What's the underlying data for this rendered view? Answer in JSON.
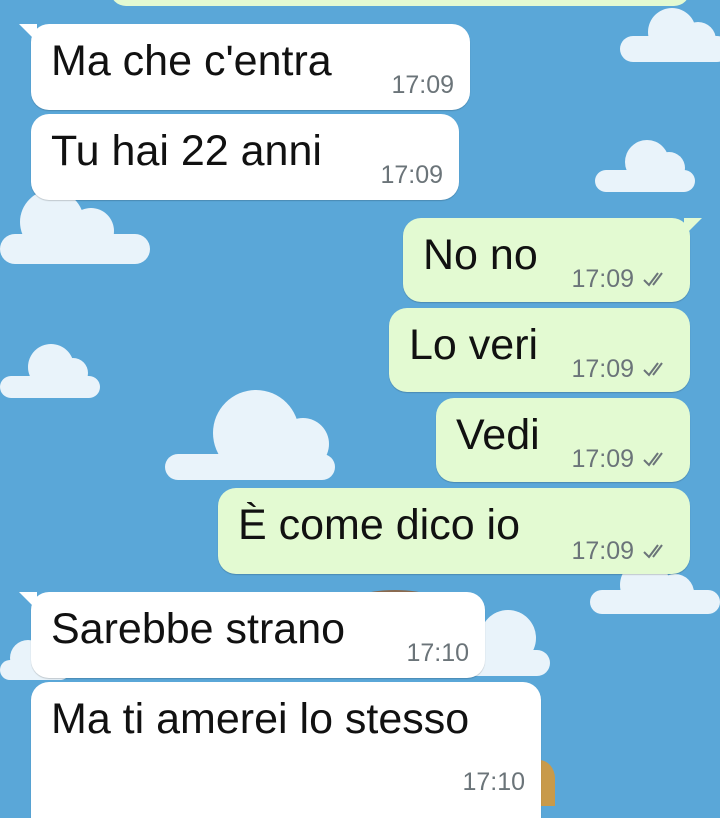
{
  "chat": {
    "messages": [
      {
        "direction": "incoming",
        "text": "Ma che c'entra",
        "time": "17:09"
      },
      {
        "direction": "incoming",
        "text": "Tu hai 22 anni",
        "time": "17:09"
      },
      {
        "direction": "outgoing",
        "text": "No no",
        "time": "17:09",
        "status": "double-check-icon"
      },
      {
        "direction": "outgoing",
        "text": "Lo veri",
        "time": "17:09",
        "status": "double-check-icon"
      },
      {
        "direction": "outgoing",
        "text": "Vedi",
        "time": "17:09",
        "status": "double-check-icon"
      },
      {
        "direction": "outgoing",
        "text": "È come dico io",
        "time": "17:09",
        "status": "double-check-icon"
      },
      {
        "direction": "incoming",
        "text": "Sarebbe strano",
        "time": "17:10"
      },
      {
        "direction": "incoming",
        "text": "Ma ti amerei lo stesso",
        "time": "17:10"
      }
    ]
  },
  "colors": {
    "wallpaper": "#5aa7d8",
    "incoming_bubble": "#ffffff",
    "outgoing_bubble": "#e3fad2",
    "timestamp": "#6b7479"
  }
}
